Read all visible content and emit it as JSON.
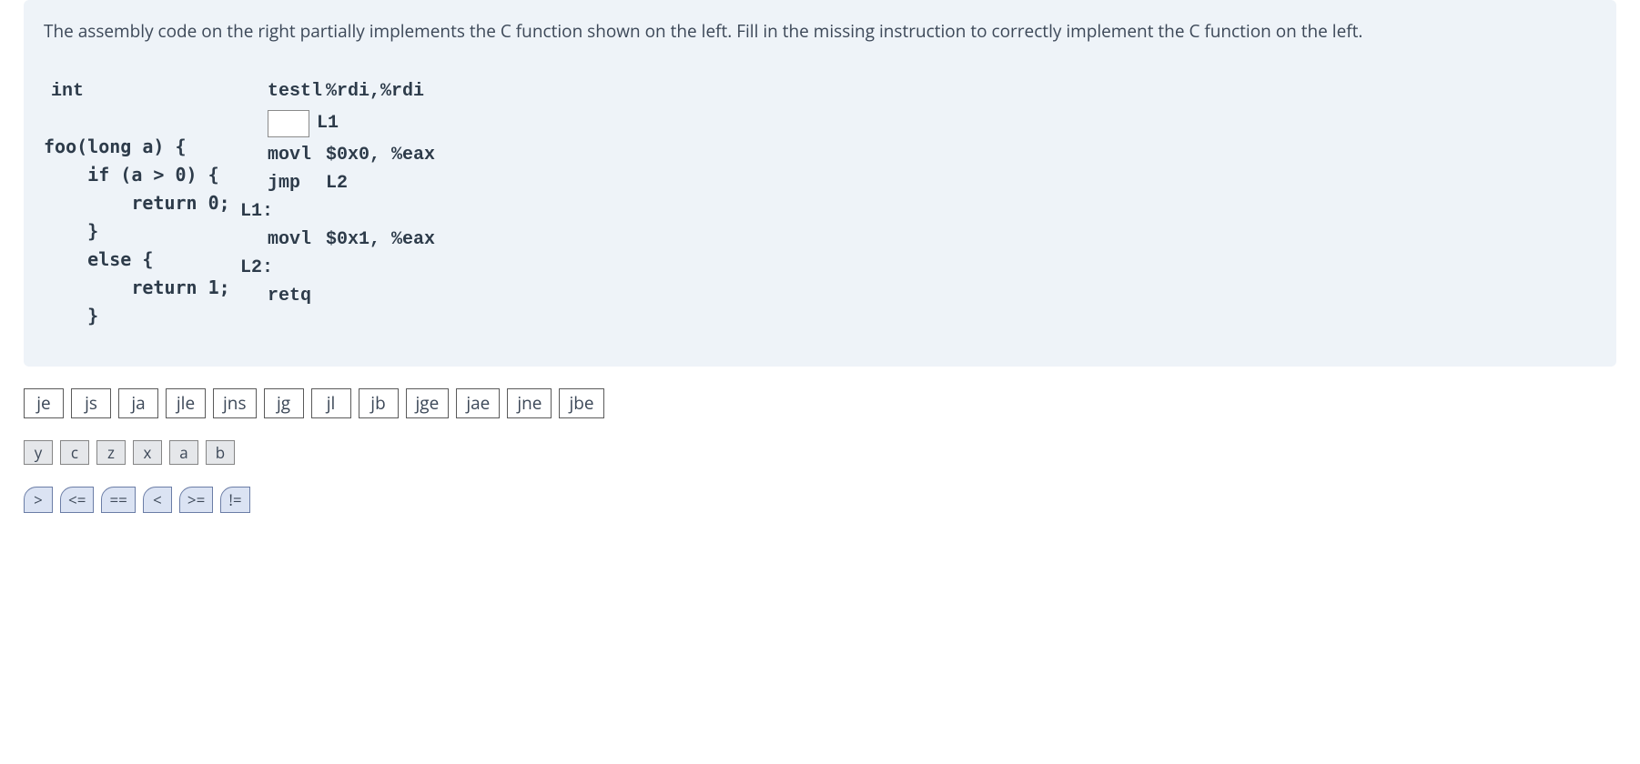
{
  "prompt": {
    "text": "The assembly code on the right partially implements the C function shown on the left. Fill in the missing instruction to correctly implement the C function on the left."
  },
  "code": {
    "c_int": "int",
    "c_lines": [
      "foo(long a) {",
      "    if (a > 0) {",
      "        return 0;",
      "    }",
      "    else {",
      "        return 1;",
      "    }"
    ],
    "asm": {
      "l1": {
        "op": "testl",
        "args": "%rdi,%rdi"
      },
      "blank_target": "L1",
      "l3": {
        "op": "movl",
        "args": "$0x0, %eax"
      },
      "l4": {
        "op": "jmp",
        "args": "L2"
      },
      "l5": "L1:",
      "l6": {
        "op": "movl",
        "args": "$0x1, %eax"
      },
      "l7": "L2:",
      "l8": {
        "op": "retq",
        "args": ""
      }
    }
  },
  "tokens": {
    "jumps": [
      "je",
      "js",
      "ja",
      "jle",
      "jns",
      "jg",
      "jl",
      "jb",
      "jge",
      "jae",
      "jne",
      "jbe"
    ],
    "vars": [
      "y",
      "c",
      "z",
      "x",
      "a",
      "b"
    ],
    "ops": [
      ">",
      "<=",
      "==",
      "<",
      ">=",
      "!="
    ]
  }
}
